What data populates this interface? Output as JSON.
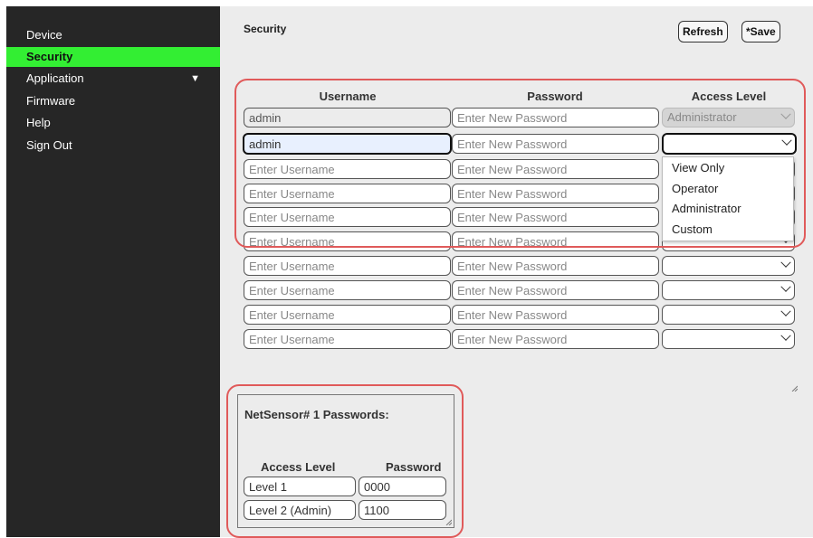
{
  "sidebar": {
    "items": [
      {
        "label": "Device"
      },
      {
        "label": "Security",
        "active": true
      },
      {
        "label": "Application",
        "caret": "▼"
      },
      {
        "label": "Firmware"
      },
      {
        "label": "Help"
      },
      {
        "label": "Sign Out"
      }
    ]
  },
  "header": {
    "title": "Security",
    "refresh_label": "Refresh",
    "save_label": "*Save"
  },
  "users_table": {
    "columns": [
      "Username",
      "Password",
      "Access Level"
    ],
    "rows": [
      {
        "username": "admin",
        "password_placeholder": "Enter New Password",
        "access": "Administrator",
        "state": "disabled"
      },
      {
        "username": "admin",
        "password_placeholder": "Enter New Password",
        "access": "",
        "state": "focused"
      },
      {
        "username_placeholder": "Enter Username",
        "password_placeholder": "Enter New Password",
        "access": ""
      },
      {
        "username_placeholder": "Enter Username",
        "password_placeholder": "Enter New Password",
        "access": ""
      },
      {
        "username_placeholder": "Enter Username",
        "password_placeholder": "Enter New Password",
        "access": ""
      },
      {
        "username_placeholder": "Enter Username",
        "password_placeholder": "Enter New Password",
        "access": ""
      },
      {
        "username_placeholder": "Enter Username",
        "password_placeholder": "Enter New Password",
        "access": ""
      },
      {
        "username_placeholder": "Enter Username",
        "password_placeholder": "Enter New Password",
        "access": ""
      },
      {
        "username_placeholder": "Enter Username",
        "password_placeholder": "Enter New Password",
        "access": ""
      },
      {
        "username_placeholder": "Enter Username",
        "password_placeholder": "Enter New Password",
        "access": ""
      }
    ],
    "access_options": [
      "View Only",
      "Operator",
      "Administrator",
      "Custom"
    ]
  },
  "netsensor": {
    "title": "NetSensor# 1 Passwords:",
    "col_access": "Access Level",
    "col_password": "Password",
    "rows": [
      {
        "level": "Level 1",
        "password": "0000"
      },
      {
        "level": "Level 2 (Admin)",
        "password": "1100"
      }
    ]
  },
  "colors": {
    "sidebar_bg": "#262626",
    "active_accent": "#33ee33",
    "content_bg": "#ececec",
    "highlight_frame": "#e05a5a"
  }
}
